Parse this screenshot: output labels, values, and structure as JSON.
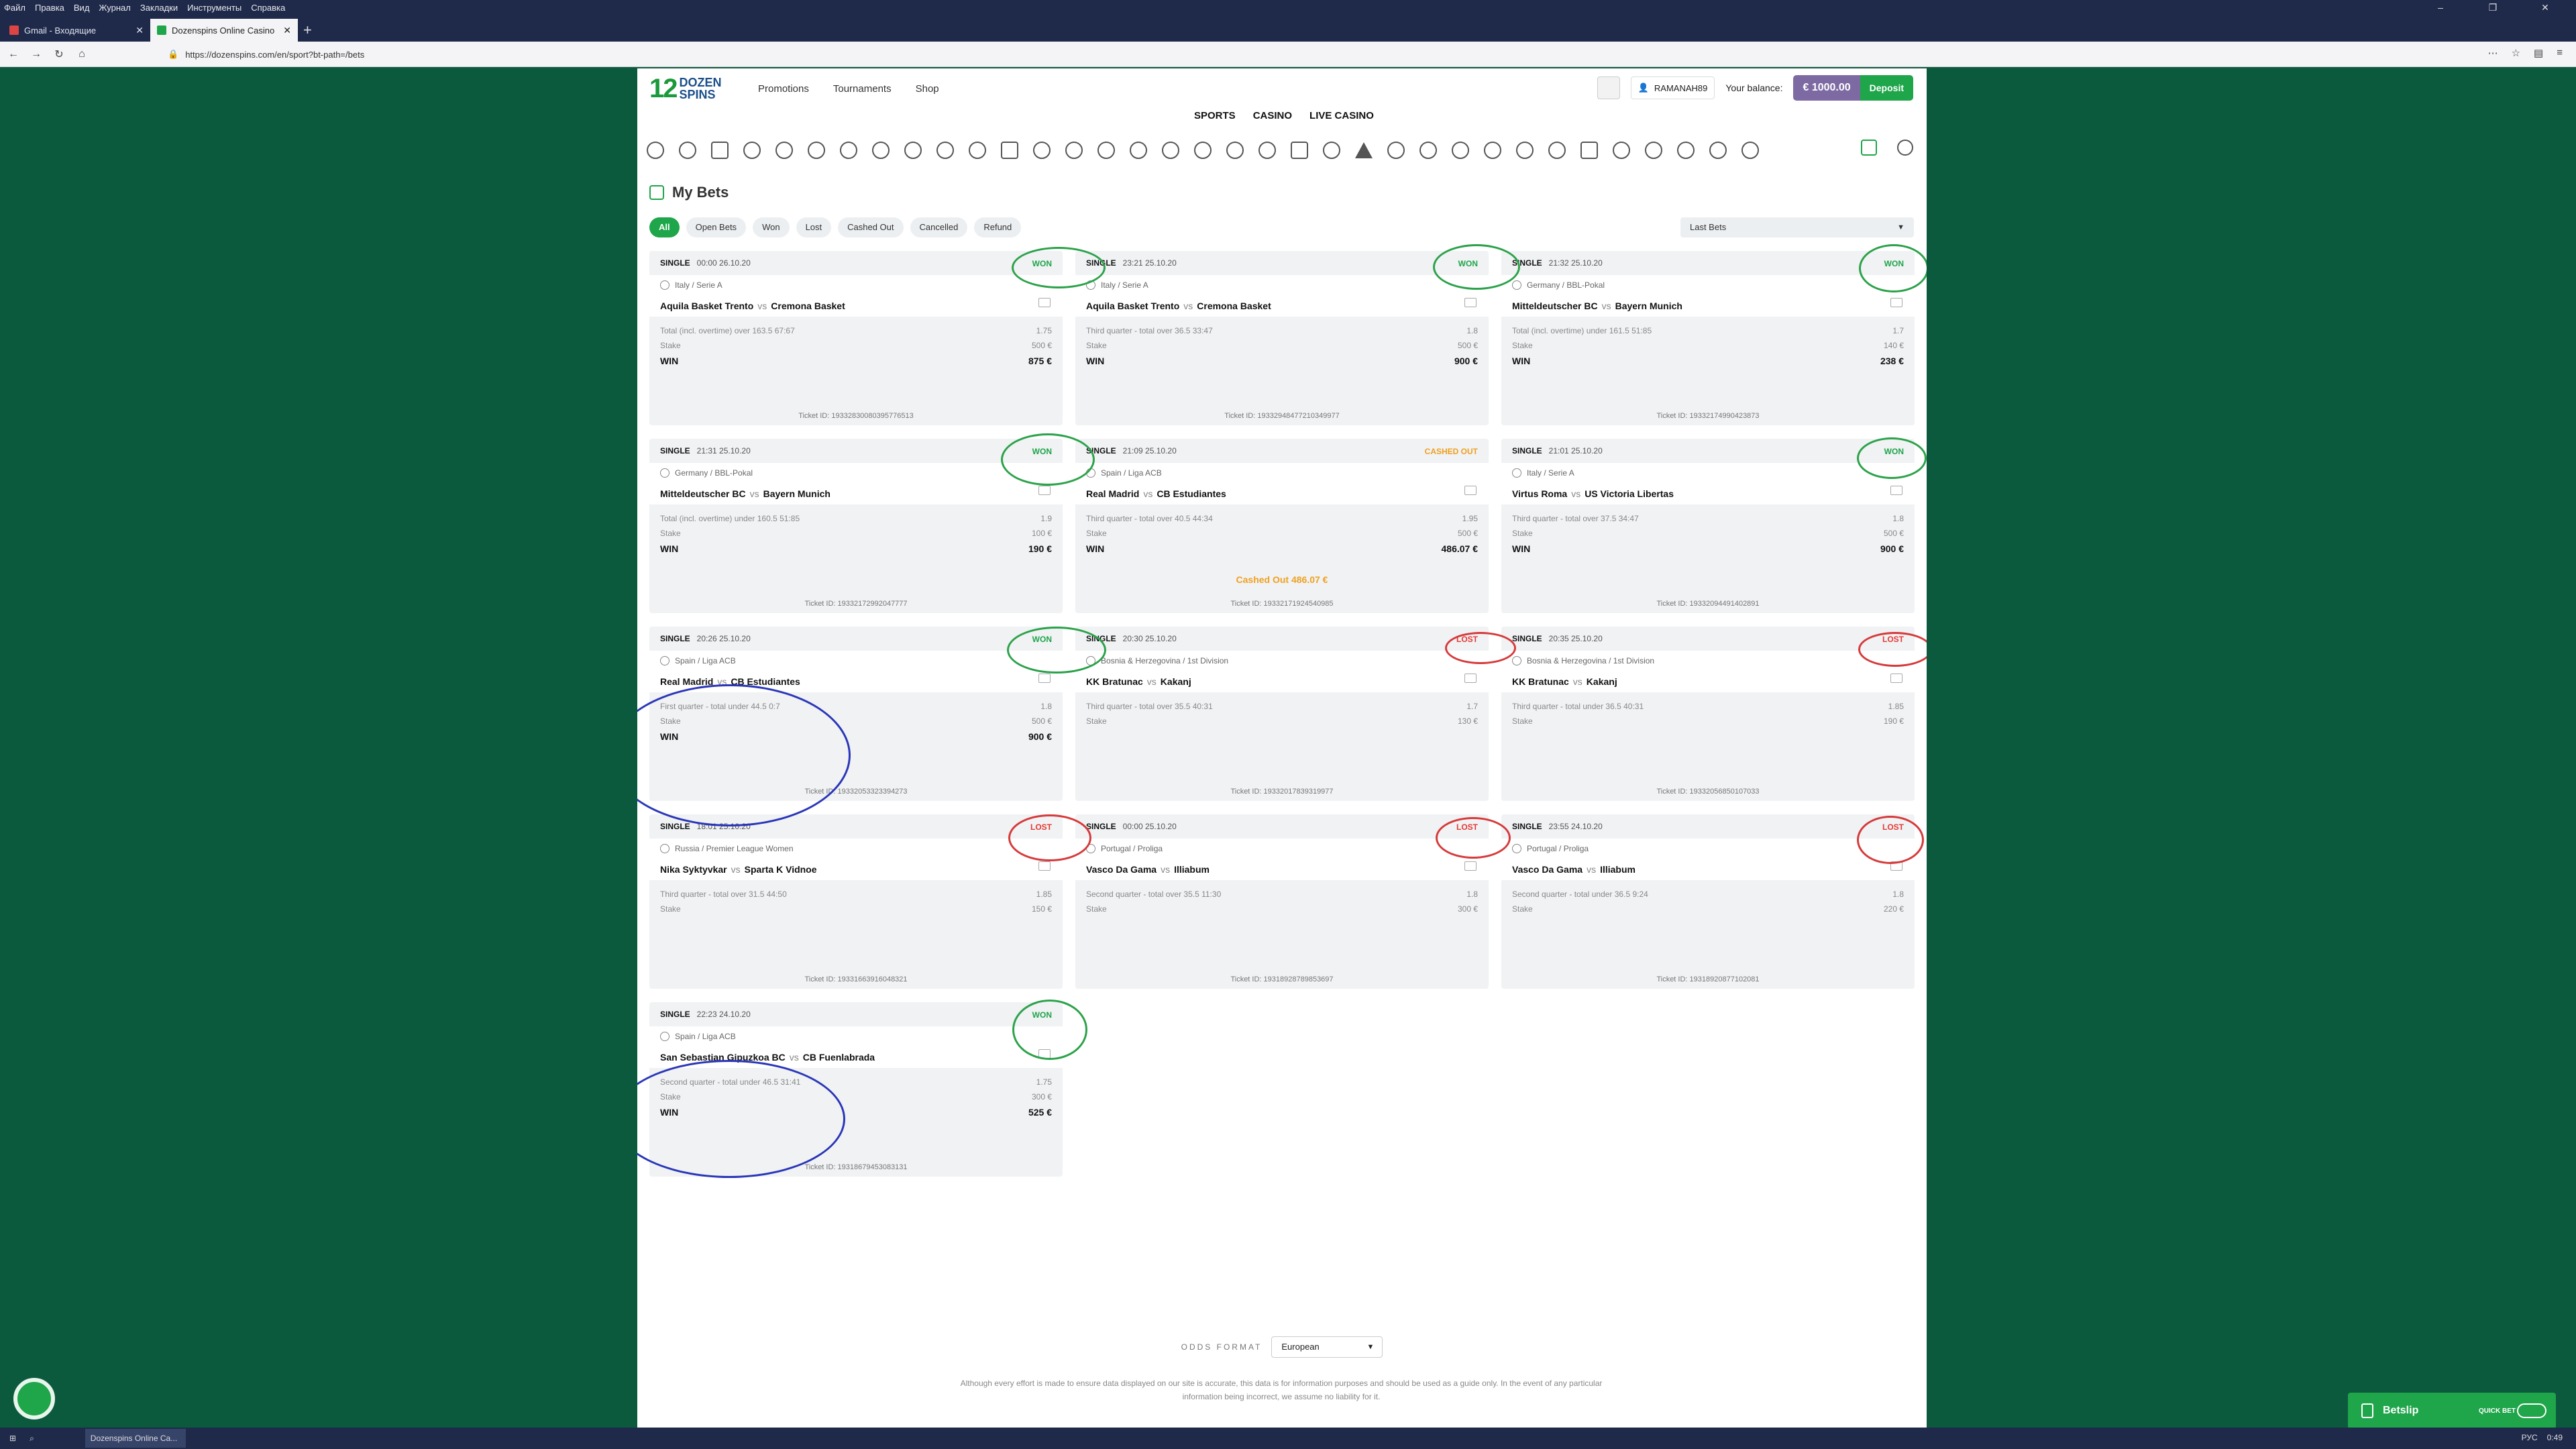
{
  "menu": [
    "Файл",
    "Правка",
    "Вид",
    "Журнал",
    "Закладки",
    "Инструменты",
    "Справка"
  ],
  "tabs": [
    {
      "label": "Gmail - Входящие"
    },
    {
      "label": "Dozenspins Online Casino"
    }
  ],
  "url": "https://dozenspins.com/en/sport?bt-path=/bets",
  "site": {
    "logo_num": "12",
    "logo_top": "DOZEN",
    "logo_bottom": "SPINS",
    "nav": [
      "Promotions",
      "Tournaments",
      "Shop"
    ],
    "username": "RAMANAH89",
    "balance_label": "Your balance:",
    "balance": "€ 1000.00",
    "deposit": "Deposit",
    "subnav": [
      "SPORTS",
      "CASINO",
      "LIVE CASINO"
    ]
  },
  "page_title": "My Bets",
  "filters": [
    "All",
    "Open Bets",
    "Won",
    "Lost",
    "Cashed Out",
    "Cancelled",
    "Refund"
  ],
  "period": "Last Bets",
  "bets": [
    {
      "type": "SINGLE",
      "time": "00:00 26.10.20",
      "status": "WON",
      "league": "Italy / Serie A",
      "home": "Aquila Basket Trento",
      "away": "Cremona Basket",
      "market": "Total (incl. overtime) over 163.5  67:67",
      "odds": "1.75",
      "stake": "500 €",
      "win": "875 €",
      "ticket": "Ticket ID: 19332830080395776513"
    },
    {
      "type": "SINGLE",
      "time": "23:21 25.10.20",
      "status": "WON",
      "league": "Italy / Serie A",
      "home": "Aquila Basket Trento",
      "away": "Cremona Basket",
      "market": "Third quarter - total over 36.5  33:47",
      "odds": "1.8",
      "stake": "500 €",
      "win": "900 €",
      "ticket": "Ticket ID: 19332948477210349977"
    },
    {
      "type": "SINGLE",
      "time": "21:32 25.10.20",
      "status": "WON",
      "league": "Germany / BBL-Pokal",
      "home": "Mitteldeutscher BC",
      "away": "Bayern Munich",
      "market": "Total (incl. overtime) under 161.5  51:85",
      "odds": "1.7",
      "stake": "140 €",
      "win": "238 €",
      "ticket": "Ticket ID: 19332174990423873"
    },
    {
      "type": "SINGLE",
      "time": "21:31 25.10.20",
      "status": "WON",
      "league": "Germany / BBL-Pokal",
      "home": "Mitteldeutscher BC",
      "away": "Bayern Munich",
      "market": "Total (incl. overtime) under 160.5  51:85",
      "odds": "1.9",
      "stake": "100 €",
      "win": "190 €",
      "ticket": "Ticket ID: 19332172992047777"
    },
    {
      "type": "SINGLE",
      "time": "21:09 25.10.20",
      "status": "CASHED OUT",
      "league": "Spain / Liga ACB",
      "home": "Real Madrid",
      "away": "CB Estudiantes",
      "market": "Third quarter - total over 40.5  44:34",
      "odds": "1.95",
      "stake": "500 €",
      "win": "486.07 €",
      "cashed": "Cashed Out 486.07 €",
      "ticket": "Ticket ID: 19332171924540985"
    },
    {
      "type": "SINGLE",
      "time": "21:01 25.10.20",
      "status": "WON",
      "league": "Italy / Serie A",
      "home": "Virtus Roma",
      "away": "US Victoria Libertas",
      "market": "Third quarter - total over 37.5  34:47",
      "odds": "1.8",
      "stake": "500 €",
      "win": "900 €",
      "ticket": "Ticket ID: 19332094491402891"
    },
    {
      "type": "SINGLE",
      "time": "20:26 25.10.20",
      "status": "WON",
      "league": "Spain / Liga ACB",
      "home": "Real Madrid",
      "away": "CB Estudiantes",
      "market": "First quarter - total under 44.5  0:7",
      "odds": "1.8",
      "stake": "500 €",
      "win": "900 €",
      "ticket": "Ticket ID: 19332053323394273"
    },
    {
      "type": "SINGLE",
      "time": "20:30 25.10.20",
      "status": "LOST",
      "league": "Bosnia & Herzegovina / 1st Division",
      "home": "KK Bratunac",
      "away": "Kakanj",
      "market": "Third quarter - total over 35.5  40:31",
      "odds": "1.7",
      "stake": "130 €",
      "ticket": "Ticket ID: 19332017839319977"
    },
    {
      "type": "SINGLE",
      "time": "20:35 25.10.20",
      "status": "LOST",
      "league": "Bosnia & Herzegovina / 1st Division",
      "home": "KK Bratunac",
      "away": "Kakanj",
      "market": "Third quarter - total under 36.5  40:31",
      "odds": "1.85",
      "stake": "190 €",
      "ticket": "Ticket ID: 19332056850107033"
    },
    {
      "type": "SINGLE",
      "time": "18:01 25.10.20",
      "status": "LOST",
      "league": "Russia / Premier League Women",
      "home": "Nika Syktyvkar",
      "away": "Sparta K Vidnoe",
      "market": "Third quarter - total over 31.5  44:50",
      "odds": "1.85",
      "stake": "150 €",
      "ticket": "Ticket ID: 19331663916048321"
    },
    {
      "type": "SINGLE",
      "time": "00:00 25.10.20",
      "status": "LOST",
      "league": "Portugal / Proliga",
      "home": "Vasco Da Gama",
      "away": "Illiabum",
      "market": "Second quarter - total over 35.5  11:30",
      "odds": "1.8",
      "stake": "300 €",
      "ticket": "Ticket ID: 19318928789853697"
    },
    {
      "type": "SINGLE",
      "time": "23:55 24.10.20",
      "status": "LOST",
      "league": "Portugal / Proliga",
      "home": "Vasco Da Gama",
      "away": "Illiabum",
      "market": "Second quarter - total under 36.5  9:24",
      "odds": "1.8",
      "stake": "220 €",
      "ticket": "Ticket ID: 19318920877102081"
    },
    {
      "type": "SINGLE",
      "time": "22:23 24.10.20",
      "status": "WON",
      "league": "Spain / Liga ACB",
      "home": "San Sebastian Gipuzkoa BC",
      "away": "CB Fuenlabrada",
      "market": "Second quarter - total under 46.5  31:41",
      "odds": "1.75",
      "stake": "300 €",
      "win": "525 €",
      "ticket": "Ticket ID: 19318679453083131"
    }
  ],
  "labels": {
    "stake": "Stake",
    "win": "WIN",
    "vs": "vs"
  },
  "odds_format_label": "ODDS FORMAT",
  "odds_format": "European",
  "disclaimer": "Although every effort is made to ensure data displayed on our site is accurate, this data is for information purposes and should be used as a guide only. In the event of any particular information being incorrect, we assume no liability for it.",
  "betslip": {
    "label": "Betslip",
    "quick": "QUICK BET"
  },
  "taskbar": {
    "app": "Dozenspins Online Ca...",
    "lang": "РУС",
    "time": "0:49"
  },
  "colors": {
    "won": "#1fa54a",
    "lost": "#e53935",
    "cashed": "#f0a020",
    "balance": "#7d6aa2"
  }
}
